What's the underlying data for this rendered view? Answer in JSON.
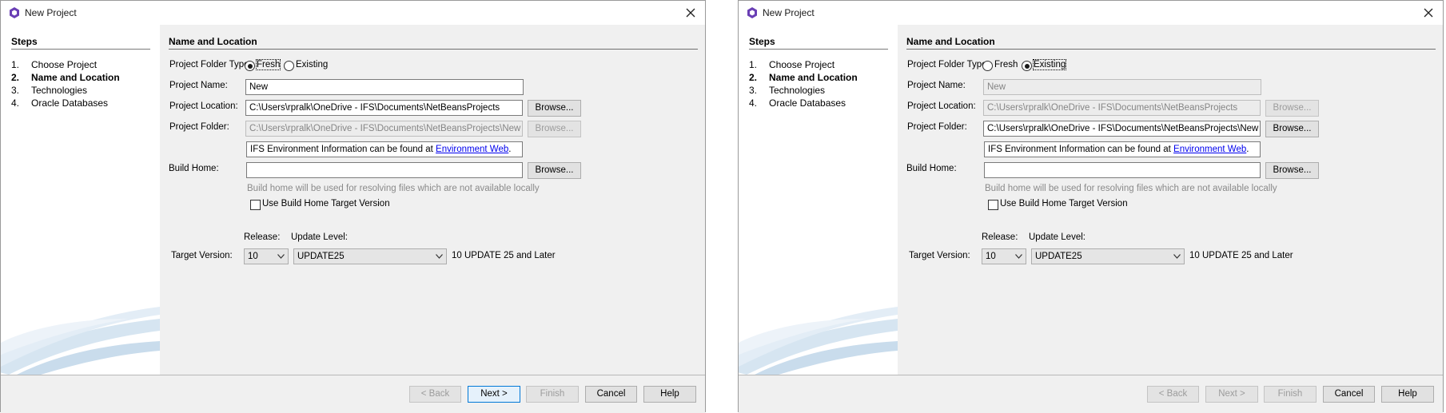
{
  "left": {
    "title": "New Project",
    "steps_title": "Steps",
    "steps": [
      {
        "num": "1.",
        "label": "Choose Project"
      },
      {
        "num": "2.",
        "label": "Name and Location"
      },
      {
        "num": "3.",
        "label": "Technologies"
      },
      {
        "num": "4.",
        "label": "Oracle Databases"
      }
    ],
    "active_step": 2,
    "section_title": "Name and Location",
    "folder_type_label": "Project Folder Type:",
    "radio_fresh": "Fresh",
    "radio_existing": "Existing",
    "selected_folder_type": "Fresh",
    "project_name_label": "Project Name:",
    "project_name_value": "New",
    "project_location_label": "Project Location:",
    "project_location_value": "C:\\Users\\rpralk\\OneDrive - IFS\\Documents\\NetBeansProjects",
    "project_folder_label": "Project Folder:",
    "project_folder_value": "C:\\Users\\rpralk\\OneDrive - IFS\\Documents\\NetBeansProjects\\New",
    "info_prefix": "IFS Environment Information can be found at ",
    "info_link": "Environment Web",
    "info_suffix": ".",
    "build_home_label": "Build Home:",
    "build_home_value": "",
    "build_home_hint": "Build home will be used for resolving files which are not available locally",
    "use_build_home": "Use Build Home Target Version",
    "release_label": "Release:",
    "update_level_label": "Update Level:",
    "target_version_label": "Target Version:",
    "release_value": "10",
    "update_value": "UPDATE25",
    "target_suffix": "10 UPDATE 25 and Later",
    "browse": "Browse...",
    "back": "< Back",
    "next": "Next >",
    "finish": "Finish",
    "cancel": "Cancel",
    "help": "Help"
  },
  "right": {
    "title": "New Project",
    "steps_title": "Steps",
    "steps": [
      {
        "num": "1.",
        "label": "Choose Project"
      },
      {
        "num": "2.",
        "label": "Name and Location"
      },
      {
        "num": "3.",
        "label": "Technologies"
      },
      {
        "num": "4.",
        "label": "Oracle Databases"
      }
    ],
    "active_step": 2,
    "section_title": "Name and Location",
    "folder_type_label": "Project Folder Type:",
    "radio_fresh": "Fresh",
    "radio_existing": "Existing",
    "selected_folder_type": "Existing",
    "project_name_label": "Project Name:",
    "project_name_value": "New",
    "project_location_label": "Project Location:",
    "project_location_value": "C:\\Users\\rpralk\\OneDrive - IFS\\Documents\\NetBeansProjects",
    "project_folder_label": "Project Folder:",
    "project_folder_value": "C:\\Users\\rpralk\\OneDrive - IFS\\Documents\\NetBeansProjects\\New",
    "info_prefix": "IFS Environment Information can be found at ",
    "info_link": "Environment Web",
    "info_suffix": ".",
    "build_home_label": "Build Home:",
    "build_home_value": "",
    "build_home_hint": "Build home will be used for resolving files which are not available locally",
    "use_build_home": "Use Build Home Target Version",
    "release_label": "Release:",
    "update_level_label": "Update Level:",
    "target_version_label": "Target Version:",
    "release_value": "10",
    "update_value": "UPDATE25",
    "target_suffix": "10 UPDATE 25 and Later",
    "browse": "Browse...",
    "back": "< Back",
    "next": "Next >",
    "finish": "Finish",
    "cancel": "Cancel",
    "help": "Help"
  },
  "colors": {
    "icon": "#6a3fb5",
    "link": "#0000ee",
    "default_button_border": "#0078d7",
    "swirl": "#c9dcec"
  },
  "icons": {
    "app": "netbeans-hexagon-icon",
    "close": "close-icon",
    "dropdown": "chevron-down-icon"
  }
}
